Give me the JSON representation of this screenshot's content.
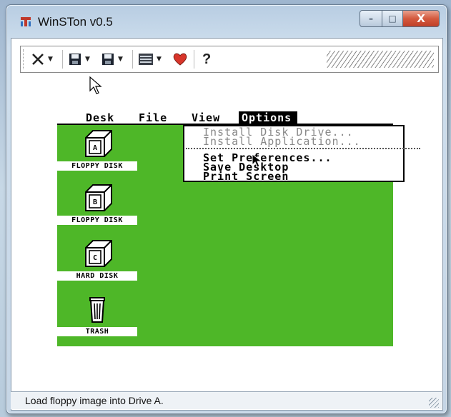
{
  "window": {
    "title": "WinSTon v0.5",
    "minimize_glyph": "–",
    "maximize_glyph": "□",
    "close_glyph": "X"
  },
  "toolbar": {
    "items": [
      {
        "icon": "close-x-icon",
        "has_dropdown": true
      },
      {
        "icon": "floppy-disk-icon",
        "has_dropdown": true
      },
      {
        "icon": "floppy-disk-icon",
        "has_dropdown": true
      },
      {
        "icon": "screen-settings-icon",
        "has_dropdown": true
      },
      {
        "icon": "heart-icon",
        "has_dropdown": false
      },
      {
        "icon": "help-icon",
        "label": "?"
      }
    ],
    "help_label": "?",
    "dropdown_glyph": "▼"
  },
  "atari": {
    "menu": {
      "desk": "Desk",
      "file": "File",
      "view": "View",
      "options": "Options"
    },
    "options_dropdown": {
      "install_disk_drive": "Install Disk Drive...",
      "install_application": "Install Application...",
      "set_preferences": "Set Preferences...",
      "save_desktop": "Save Desktop",
      "print_screen": "Print Screen"
    },
    "icons": [
      {
        "label": "FLOPPY DISK",
        "letter": "A"
      },
      {
        "label": "FLOPPY DISK",
        "letter": "B"
      },
      {
        "label": "HARD DISK",
        "letter": "C"
      },
      {
        "label": "TRASH"
      }
    ]
  },
  "status": {
    "text": "Load floppy image into Drive A."
  },
  "colors": {
    "desktop_green": "#4eb728",
    "heart_red": "#d8352a",
    "close_red": "#c9472f"
  }
}
